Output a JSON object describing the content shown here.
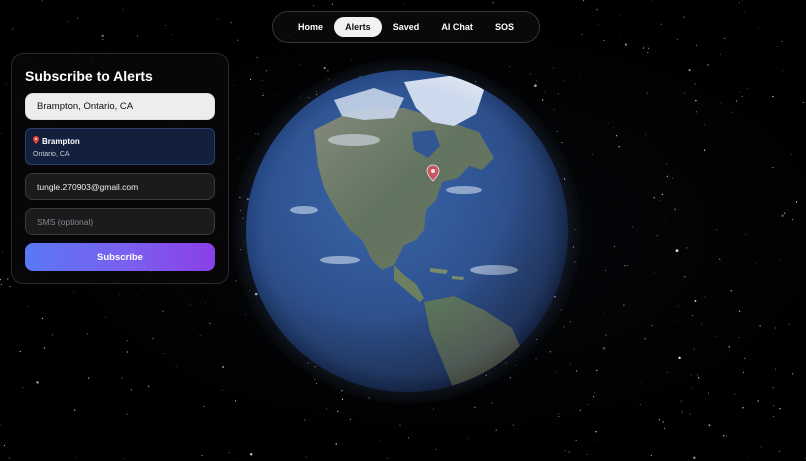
{
  "nav": {
    "items": [
      {
        "label": "Home",
        "active": false
      },
      {
        "label": "Alerts",
        "active": true
      },
      {
        "label": "Saved",
        "active": false
      },
      {
        "label": "AI Chat",
        "active": false
      },
      {
        "label": "SOS",
        "active": false
      }
    ]
  },
  "subscribe": {
    "title": "Subscribe to Alerts",
    "location_value": "Brampton, Ontario, CA",
    "suggestion": {
      "name": "Brampton",
      "region": "Ontario, CA",
      "icon": "map-pin-icon"
    },
    "email_value": "tungle.270903@gmail.com",
    "sms_placeholder": "SMS (optional)",
    "button_label": "Subscribe"
  },
  "globe": {
    "marker_icon": "map-pin-icon",
    "marker_color": "#e8433a"
  },
  "colors": {
    "accent_start": "#5a78f4",
    "accent_end": "#8a3fe6",
    "suggestion_bg": "#12203e",
    "ocean": "#1c3d78"
  }
}
